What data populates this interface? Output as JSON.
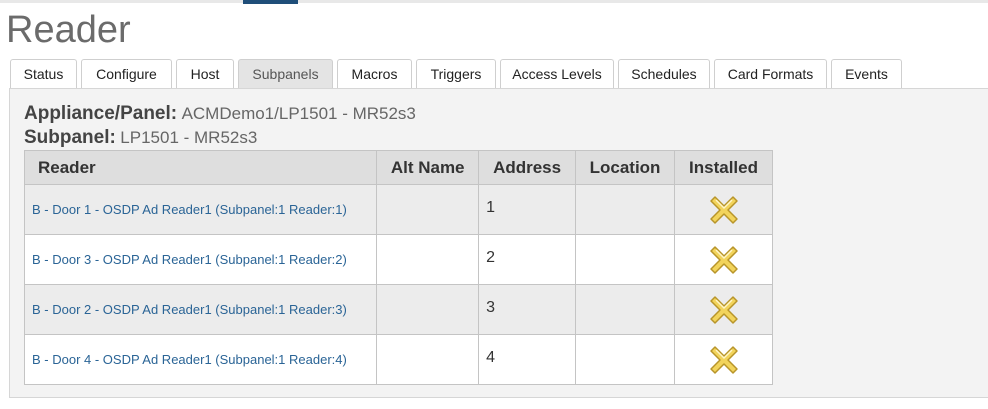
{
  "page": {
    "title": "Reader"
  },
  "tabs": [
    {
      "label": "Status",
      "active": false
    },
    {
      "label": "Configure",
      "active": false
    },
    {
      "label": "Host",
      "active": false
    },
    {
      "label": "Subpanels",
      "active": true
    },
    {
      "label": "Macros",
      "active": false
    },
    {
      "label": "Triggers",
      "active": false
    },
    {
      "label": "Access Levels",
      "active": false
    },
    {
      "label": "Schedules",
      "active": false
    },
    {
      "label": "Card Formats",
      "active": false
    },
    {
      "label": "Events",
      "active": false
    }
  ],
  "info": {
    "appliance_label": "Appliance/Panel:",
    "appliance_value": "ACMDemo1/LP1501 - MR52s3",
    "subpanel_label": "Subpanel:",
    "subpanel_value": "LP1501 - MR52s3"
  },
  "table": {
    "headers": {
      "reader": "Reader",
      "alt_name": "Alt Name",
      "address": "Address",
      "location": "Location",
      "installed": "Installed"
    },
    "rows": [
      {
        "reader": "B - Door 1 - OSDP Ad Reader1 (Subpanel:1 Reader:1)",
        "alt_name": "",
        "address": "1",
        "location": "",
        "installed_icon": "x-icon"
      },
      {
        "reader": "B - Door 3 - OSDP Ad Reader1 (Subpanel:1 Reader:2)",
        "alt_name": "",
        "address": "2",
        "location": "",
        "installed_icon": "x-icon"
      },
      {
        "reader": "B - Door 2 - OSDP Ad Reader1 (Subpanel:1 Reader:3)",
        "alt_name": "",
        "address": "3",
        "location": "",
        "installed_icon": "x-icon"
      },
      {
        "reader": "B - Door 4 - OSDP Ad Reader1 (Subpanel:1 Reader:4)",
        "alt_name": "",
        "address": "4",
        "location": "",
        "installed_icon": "x-icon"
      }
    ]
  },
  "colors": {
    "link": "#2a6496",
    "accent": "#1f4e79",
    "icon_fill": "#f2d45c",
    "icon_stroke": "#b8952a"
  }
}
